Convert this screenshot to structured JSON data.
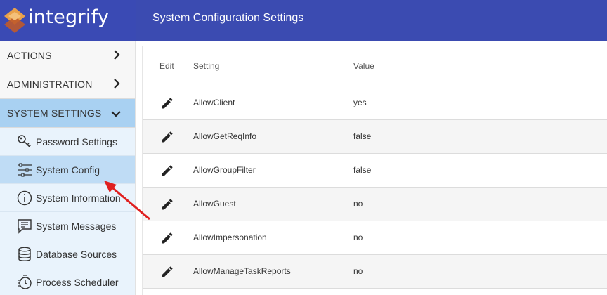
{
  "app": {
    "logo_text": "integrify",
    "page_title": "System Configuration Settings"
  },
  "sidebar": {
    "sections": [
      {
        "label": "ACTIONS",
        "expanded": false
      },
      {
        "label": "ADMINISTRATION",
        "expanded": false
      },
      {
        "label": "SYSTEM SETTINGS",
        "expanded": true
      }
    ],
    "items": [
      {
        "label": "Password Settings",
        "icon": "key-icon"
      },
      {
        "label": "System Config",
        "icon": "sliders-icon",
        "active": true
      },
      {
        "label": "System Information",
        "icon": "info-icon"
      },
      {
        "label": "System Messages",
        "icon": "message-icon"
      },
      {
        "label": "Database Sources",
        "icon": "database-icon"
      },
      {
        "label": "Process Scheduler",
        "icon": "scheduler-icon"
      }
    ]
  },
  "table": {
    "headers": {
      "edit": "Edit",
      "setting": "Setting",
      "value": "Value"
    },
    "rows": [
      {
        "setting": "AllowClient",
        "value": "yes"
      },
      {
        "setting": "AllowGetReqInfo",
        "value": "false"
      },
      {
        "setting": "AllowGroupFilter",
        "value": "false"
      },
      {
        "setting": "AllowGuest",
        "value": "no"
      },
      {
        "setting": "AllowImpersonation",
        "value": "no"
      },
      {
        "setting": "AllowManageTaskReports",
        "value": "no"
      }
    ]
  },
  "colors": {
    "header": "#3b4bb1",
    "active_section": "#a9d1f2",
    "active_item": "#bfdcf5",
    "arrow": "#e02020"
  }
}
